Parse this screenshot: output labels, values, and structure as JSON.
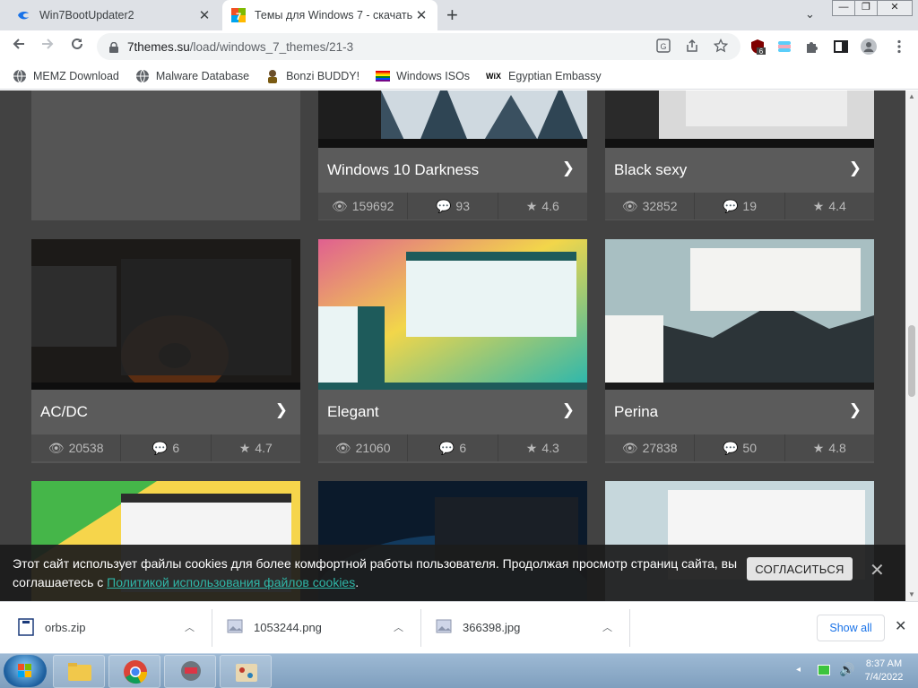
{
  "tabs": [
    {
      "title": "Win7BootUpdater2",
      "close": "✕"
    },
    {
      "title": "Темы для Windows 7 - скачать т",
      "close": "✕"
    }
  ],
  "new_tab": "+",
  "tab_dropdown": "⌄",
  "window_controls": {
    "minimize": "—",
    "restore": "❐",
    "close": "✕"
  },
  "toolbar": {
    "url_host": "7themes.su",
    "url_path": "/load/windows_7_themes/21-3",
    "extension_badge": "6"
  },
  "bookmarks": [
    {
      "label": "MEMZ Download",
      "icon": "globe-icon"
    },
    {
      "label": "Malware Database",
      "icon": "globe-icon"
    },
    {
      "label": "Bonzi BUDDY!",
      "icon": "bonzi-icon"
    },
    {
      "label": "Windows ISOs",
      "icon": "rainbow-flag-icon"
    },
    {
      "label": "Egyptian Embassy",
      "icon": "wix-icon"
    }
  ],
  "cards": [
    {
      "name": "Windows 10 Darkness",
      "views": "159692",
      "comments": "93",
      "rating": "4.6"
    },
    {
      "name": "Black sexy",
      "views": "32852",
      "comments": "19",
      "rating": "4.4"
    },
    {
      "name": "AC/DC",
      "views": "20538",
      "comments": "6",
      "rating": "4.7"
    },
    {
      "name": "Elegant",
      "views": "21060",
      "comments": "6",
      "rating": "4.3"
    },
    {
      "name": "Perina",
      "views": "27838",
      "comments": "50",
      "rating": "4.8"
    }
  ],
  "cookie": {
    "text": "Этот сайт использует файлы cookies для более комфортной работы пользователя. Продолжая просмотр страниц сайта, вы соглашаетесь с ",
    "link": "Политикой использования файлов cookies",
    "end": ".",
    "accept": "СОГЛАСИТЬСЯ",
    "close": "✕"
  },
  "downloads": [
    {
      "name": "orbs.zip"
    },
    {
      "name": "1053244.png"
    },
    {
      "name": "366398.jpg"
    }
  ],
  "show_all": "Show all",
  "downloads_close": "✕",
  "clock": {
    "time": "8:37 AM",
    "date": "7/4/2022"
  }
}
